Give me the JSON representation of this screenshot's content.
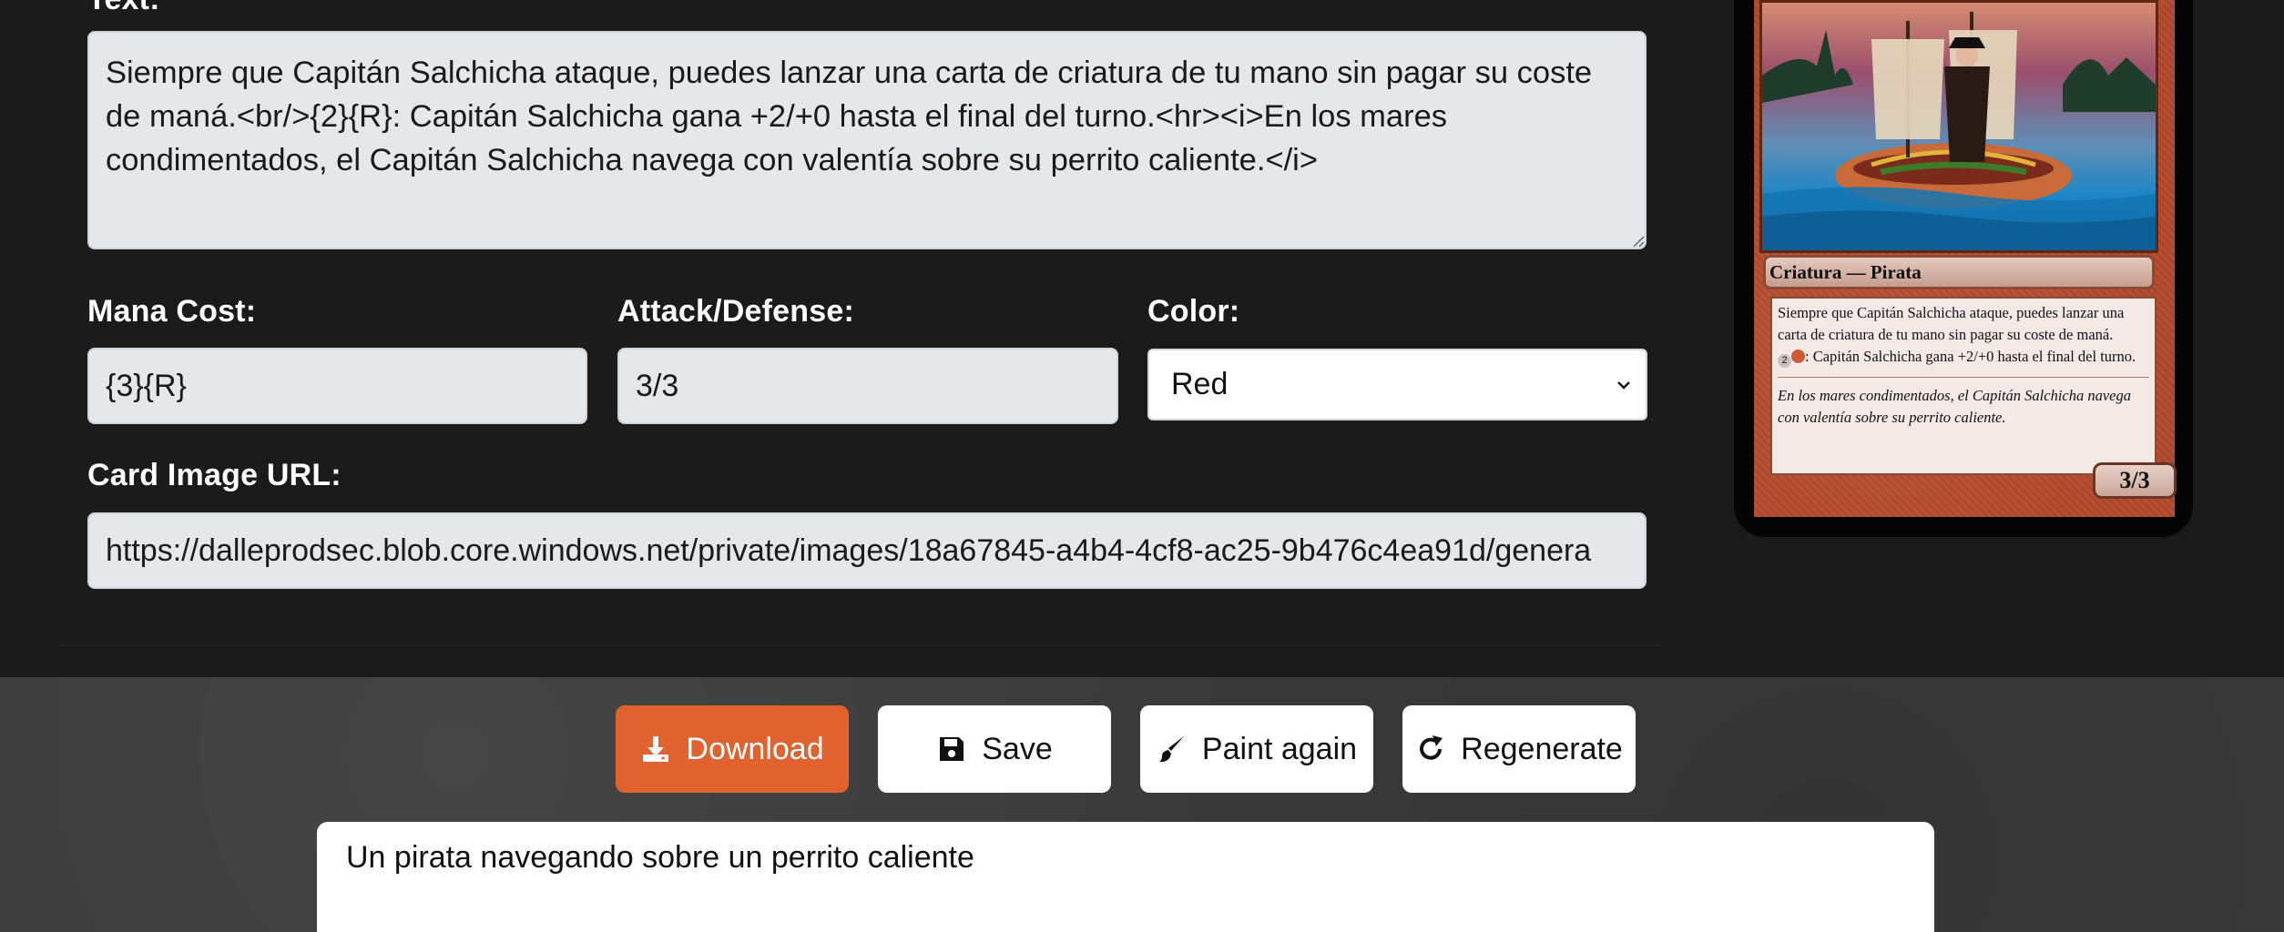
{
  "form": {
    "text_label": "Text:",
    "text_value": "Siempre que Capitán Salchicha ataque, puedes lanzar una carta de criatura de tu mano sin pagar su coste de maná.<br/>{2}{R}: Capitán Salchicha gana +2/+0 hasta el final del turno.<hr><i>En los mares condimentados, el Capitán Salchicha navega con valentía sobre su perrito caliente.</i>",
    "mana_label": "Mana Cost:",
    "mana_value": "{3}{R}",
    "attack_label": "Attack/Defense:",
    "attack_value": "3/3",
    "color_label": "Color:",
    "color_value": "Red",
    "image_url_label": "Card Image URL:",
    "image_url_value": "https://dalleprodsec.blob.core.windows.net/private/images/18a67845-a4b4-4cf8-ac25-9b476c4ea91d/genera"
  },
  "card": {
    "type_line": "Criatura — Pirata",
    "rules_line1": "Siempre que Capitán Salchicha ataque, puedes lanzar una carta de criatura de tu mano sin pagar su coste de maná.",
    "rules_line2_cost": "2",
    "rules_line2_text": ": Capitán Salchicha gana +2/+0 hasta el final del turno.",
    "flavor": "En los mares condimentados, el Capitán Salchicha navega con valentía sobre su perrito caliente.",
    "power_toughness": "3/3"
  },
  "actions": {
    "download": "Download",
    "save": "Save",
    "paint_again": "Paint again",
    "regenerate": "Regenerate"
  },
  "prompt": {
    "value": "Un pirata navegando sobre un perrito caliente"
  },
  "colors": {
    "accent": "#e0622f",
    "editor_bg": "#1b1b1b",
    "card_frame": "#b4492b"
  }
}
